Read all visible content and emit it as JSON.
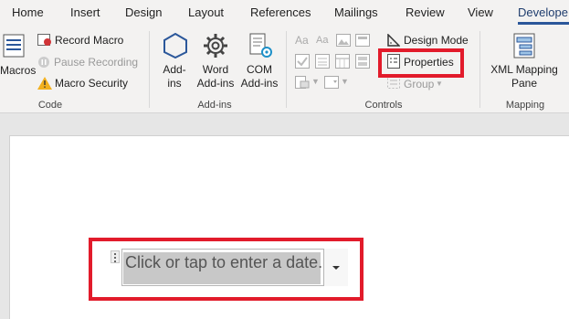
{
  "tabs": [
    "Home",
    "Insert",
    "Design",
    "Layout",
    "References",
    "Mailings",
    "Review",
    "View",
    "Develope"
  ],
  "code_group": {
    "macros_label": "Macros",
    "record_macro": "Record Macro",
    "pause_recording": "Pause Recording",
    "macro_security": "Macro Security",
    "group_label": "Code"
  },
  "addins_group": {
    "addins_label_1": "Add-",
    "addins_label_2": "ins",
    "word_addins_1": "Word",
    "word_addins_2": "Add-ins",
    "com_addins_1": "COM",
    "com_addins_2": "Add-ins",
    "group_label": "Add-ins"
  },
  "controls_group": {
    "design_mode": "Design Mode",
    "properties": "Properties",
    "group": "Group",
    "group_label": "Controls"
  },
  "mapping_group": {
    "xml_mapping_1": "XML Mapping",
    "xml_mapping_2": "Pane",
    "group_label": "Mapping"
  },
  "document": {
    "date_placeholder": "Click or tap to enter a date."
  },
  "colors": {
    "highlight_red": "#e21b2b",
    "accent_blue": "#2b579a"
  }
}
